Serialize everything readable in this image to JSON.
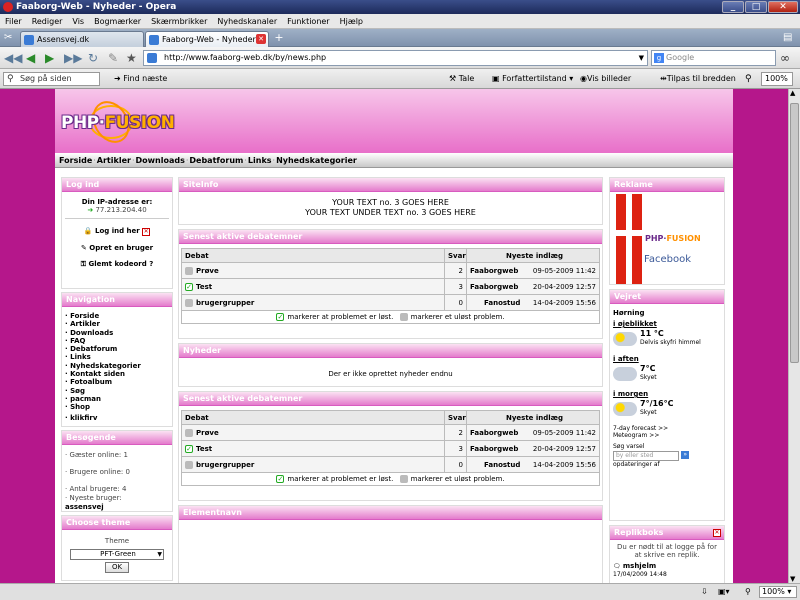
{
  "window": {
    "title": "Faaborg-Web - Nyheder - Opera"
  },
  "menu": [
    "Filer",
    "Rediger",
    "Vis",
    "Bogmærker",
    "Skærmbrikker",
    "Nyhedskanaler",
    "Funktioner",
    "Hjælp"
  ],
  "tabs": [
    {
      "label": "Assensvej.dk"
    },
    {
      "label": "Faaborg-Web - Nyheder"
    }
  ],
  "address": {
    "url": "http://www.faaborg-web.dk/by/news.php"
  },
  "search": {
    "placeholder": "Google"
  },
  "findbar": {
    "find_placeholder": "Søg på siden",
    "find_next": "Find næste",
    "speak": "Tale",
    "author_mode": "Forfattertilstand",
    "show_images": "Vis billeder",
    "fit_width": "Tilpas til bredden",
    "zoom": "100%"
  },
  "status": {
    "zoom": "100%"
  },
  "site": {
    "logo_left": "PHP",
    "logo_right": "FUSION",
    "nav": [
      "Forside",
      "Artikler",
      "Downloads",
      "Debatforum",
      "Links",
      "Nyhedskategorier"
    ]
  },
  "login": {
    "title": "Log ind",
    "ip_label": "Din IP-adresse er:",
    "ip": "77.213.204.40",
    "login_here": "Log ind her",
    "create_user": "Opret en bruger",
    "forgot": "Glemt kodeord ?"
  },
  "navigation": {
    "title": "Navigation",
    "items": [
      "Forside",
      "Artikler",
      "Downloads",
      "FAQ",
      "Debatforum",
      "Links",
      "Nyhedskategorier",
      "Kontakt siden",
      "Fotoalbum",
      "Søg",
      "pacman",
      "Shop",
      "klikfirv"
    ]
  },
  "visitors": {
    "title": "Besøgende",
    "guests": "Gæster online: 1",
    "users": "Brugere online: 0",
    "count": "Antal brugere: 4",
    "newest_label": "Nyeste bruger:",
    "newest": "assensvej"
  },
  "theme": {
    "title": "Choose theme",
    "label": "Theme",
    "selected": "PFT-Green",
    "ok": "OK"
  },
  "siteinfo": {
    "title": "SiteInfo",
    "line1": "YOUR TEXT no. 3 GOES HERE",
    "line2": "YOUR TEXT UNDER TEXT no. 3 GOES HERE"
  },
  "forum": {
    "title": "Senest aktive debatemner",
    "headers": [
      "Debat",
      "Svar",
      "Nyeste indlæg"
    ],
    "rows": [
      {
        "topic": "Prøve",
        "replies": "2",
        "user": "Faaborgweb",
        "date": "09-05-2009 11:42"
      },
      {
        "topic": "Test",
        "replies": "3",
        "user": "Faaborgweb",
        "date": "20-04-2009 12:57"
      },
      {
        "topic": "brugergrupper",
        "replies": "0",
        "user": "Fanostud",
        "date": "14-04-2009 15:56"
      }
    ],
    "legend_solved": "markerer at problemet er løst.",
    "legend_unsolved": "markerer et uløst problem."
  },
  "news": {
    "title": "Nyheder",
    "empty": "Der er ikke oprettet nyheder endnu"
  },
  "elementnavn": {
    "title": "Elementnavn"
  },
  "ads": {
    "title": "Reklame",
    "text": "Facebook"
  },
  "weather": {
    "title": "Vejret",
    "city": "Hørning",
    "now_label": "i øjeblikket",
    "now_temp": "11 °C",
    "now_desc": "Delvis skyfri himmel",
    "tonight_label": "i aften",
    "tonight_temp": "7°C",
    "tonight_desc": "Skyet",
    "tomorrow_label": "i morgen",
    "tomorrow_temp": "7°/16°C",
    "tomorrow_desc": "Skyet",
    "forecast": "7-day forecast >>",
    "meteogram": "Meteogram >>",
    "search_label": "Søg varsel",
    "search_placeholder": "by eller sted",
    "updates": "opdateringer af"
  },
  "shoutbox": {
    "title": "Replikboks",
    "notice": "Du er nødt til at logge på for at skrive en replik.",
    "user": "mshjelm",
    "date": "17/04/2009 14:48"
  }
}
